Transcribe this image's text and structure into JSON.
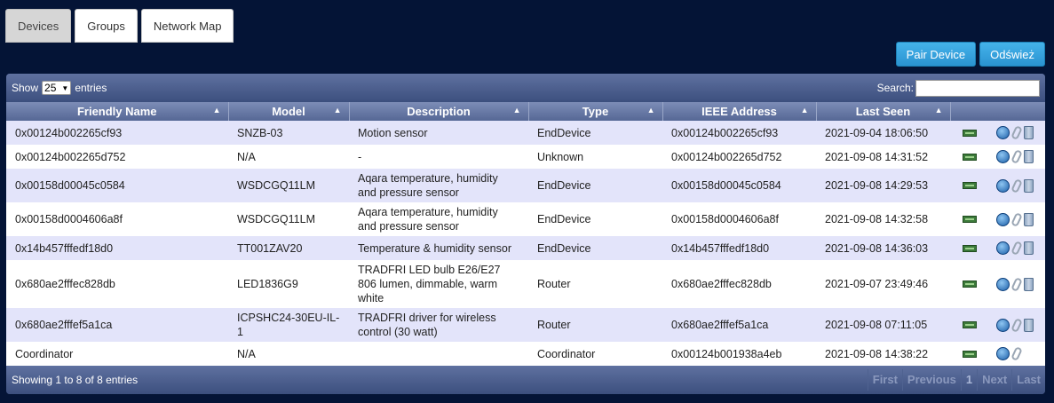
{
  "tabs": [
    {
      "label": "Devices",
      "active": true
    },
    {
      "label": "Groups",
      "active": false
    },
    {
      "label": "Network Map",
      "active": false
    }
  ],
  "buttons": {
    "pair": "Pair Device",
    "refresh": "Odśwież"
  },
  "toolbar": {
    "show": "Show",
    "entries_value": "25",
    "entries": "entries",
    "search": "Search:"
  },
  "columns": [
    "Friendly Name",
    "Model",
    "Description",
    "Type",
    "IEEE Address",
    "Last Seen"
  ],
  "rows": [
    {
      "name": "0x00124b002265cf93",
      "model": "SNZB-03",
      "desc": "Motion sensor",
      "type": "EndDevice",
      "ieee": "0x00124b002265cf93",
      "seen": "2021-09-04 18:06:50",
      "trash": true
    },
    {
      "name": "0x00124b002265d752",
      "model": "N/A",
      "desc": "-",
      "type": "Unknown",
      "ieee": "0x00124b002265d752",
      "seen": "2021-09-08 14:31:52",
      "trash": true
    },
    {
      "name": "0x00158d00045c0584",
      "model": "WSDCGQ11LM",
      "desc": "Aqara temperature, humidity and pressure sensor",
      "type": "EndDevice",
      "ieee": "0x00158d00045c0584",
      "seen": "2021-09-08 14:29:53",
      "trash": true
    },
    {
      "name": "0x00158d0004606a8f",
      "model": "WSDCGQ11LM",
      "desc": "Aqara temperature, humidity and pressure sensor",
      "type": "EndDevice",
      "ieee": "0x00158d0004606a8f",
      "seen": "2021-09-08 14:32:58",
      "trash": true
    },
    {
      "name": "0x14b457fffedf18d0",
      "model": "TT001ZAV20",
      "desc": "Temperature & humidity sensor",
      "type": "EndDevice",
      "ieee": "0x14b457fffedf18d0",
      "seen": "2021-09-08 14:36:03",
      "trash": true
    },
    {
      "name": "0x680ae2fffec828db",
      "model": "LED1836G9",
      "desc": "TRADFRI LED bulb E26/E27 806 lumen, dimmable, warm white",
      "type": "Router",
      "ieee": "0x680ae2fffec828db",
      "seen": "2021-09-07 23:49:46",
      "trash": true
    },
    {
      "name": "0x680ae2fffef5a1ca",
      "model": "ICPSHC24-30EU-IL-1",
      "desc": "TRADFRI driver for wireless control (30 watt)",
      "type": "Router",
      "ieee": "0x680ae2fffef5a1ca",
      "seen": "2021-09-08 07:11:05",
      "trash": true
    },
    {
      "name": "Coordinator",
      "model": "N/A",
      "desc": "",
      "type": "Coordinator",
      "ieee": "0x00124b001938a4eb",
      "seen": "2021-09-08 14:38:22",
      "trash": false
    }
  ],
  "footer": {
    "info": "Showing 1 to 8 of 8 entries",
    "pager": [
      "First",
      "Previous",
      "1",
      "Next",
      "Last"
    ]
  },
  "icons": {
    "network": "network-card-icon",
    "ota": "globe-icon",
    "edit": "paperclip-icon",
    "delete": "trash-icon",
    "sort": "sort-arrow-icon",
    "select": "chevron-down-icon"
  }
}
